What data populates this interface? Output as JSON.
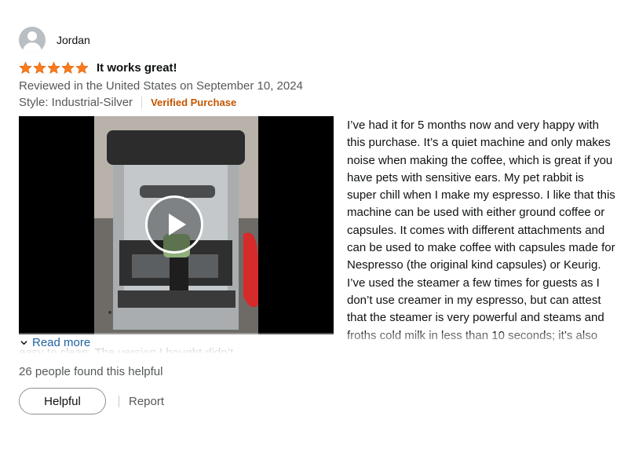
{
  "review": {
    "author": "Jordan",
    "rating": 5,
    "rating_max": 5,
    "star_color": "#ff7a1a",
    "title": "It works great!",
    "date": "Reviewed in the United States on September 10, 2024",
    "style": "Style: Industrial-Silver",
    "verified": "Verified Purchase",
    "text": "I’ve had it for 5 months now and very happy with this purchase. It’s a quiet machine and only makes noise when making the coffee, which is great if you have pets with sensitive ears. My pet rabbit is super chill when I make my espresso. I like that this machine can be used with either ground coffee or capsules. It comes with different attachments and can be used to make coffee with capsules made for Nespresso (the original kind capsules) or Keurig. I’ve used the steamer a few times for guests as I don’t use creamer in my espresso, but can attest that the steamer is very powerful and steams and froths cold milk in less than 10 seconds; it’s also easy to clean. The version I bought didn’t",
    "read_more": "Read more",
    "helpful_count": "26 people found this helpful",
    "helpful_button": "Helpful",
    "report_link": "Report"
  },
  "icons": {
    "avatar": "default-user-avatar",
    "star": "star-icon",
    "play": "play-icon",
    "chevron": "chevron-down-icon"
  },
  "colors": {
    "link": "#2162a1",
    "verified": "#c45500",
    "muted_text": "#565959"
  }
}
